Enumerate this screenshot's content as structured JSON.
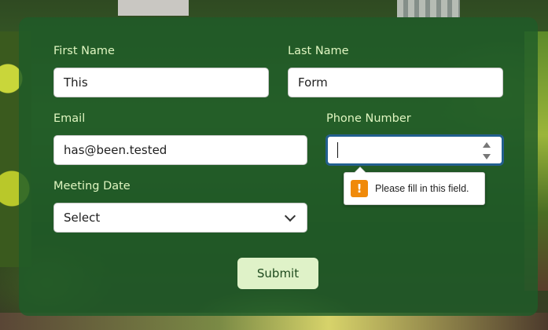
{
  "form": {
    "first_name": {
      "label": "First Name",
      "value": "This"
    },
    "last_name": {
      "label": "Last Name",
      "value": "Form"
    },
    "email": {
      "label": "Email",
      "value": "has@been.tested"
    },
    "phone": {
      "label": "Phone Number",
      "value": ""
    },
    "meeting_date": {
      "label": "Meeting Date",
      "selected": "Select"
    },
    "submit_label": "Submit"
  },
  "validation_tooltip": {
    "icon": "warning-icon",
    "message": "Please fill in this field."
  },
  "colors": {
    "panel": "#1f5c28",
    "label": "#dff5c0",
    "submit_bg": "#dff2c8",
    "focus_border": "#1f5f8f",
    "warning": "#f08a0a"
  }
}
